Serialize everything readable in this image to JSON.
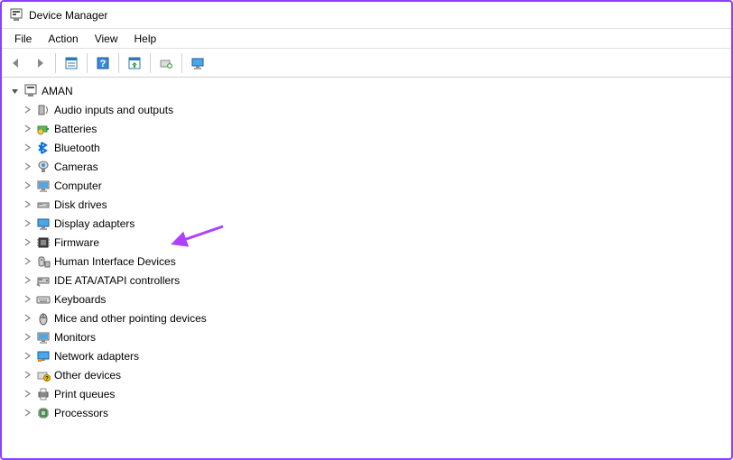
{
  "window": {
    "title": "Device Manager"
  },
  "menubar": {
    "items": [
      {
        "label": "File"
      },
      {
        "label": "Action"
      },
      {
        "label": "View"
      },
      {
        "label": "Help"
      }
    ]
  },
  "toolbar": {
    "buttons": [
      "back",
      "forward",
      "sep",
      "show-hidden",
      "help",
      "sep",
      "scan-hardware",
      "add-legacy",
      "sep",
      "remote"
    ]
  },
  "tree": {
    "root": {
      "label": "AMAN",
      "expanded": true
    },
    "categories": [
      {
        "icon": "audio",
        "label": "Audio inputs and outputs"
      },
      {
        "icon": "battery",
        "label": "Batteries"
      },
      {
        "icon": "bluetooth",
        "label": "Bluetooth"
      },
      {
        "icon": "camera",
        "label": "Cameras"
      },
      {
        "icon": "computer",
        "label": "Computer"
      },
      {
        "icon": "disk",
        "label": "Disk drives"
      },
      {
        "icon": "display",
        "label": "Display adapters"
      },
      {
        "icon": "firmware",
        "label": "Firmware"
      },
      {
        "icon": "hid",
        "label": "Human Interface Devices"
      },
      {
        "icon": "ide",
        "label": "IDE ATA/ATAPI controllers"
      },
      {
        "icon": "keyboard",
        "label": "Keyboards"
      },
      {
        "icon": "mouse",
        "label": "Mice and other pointing devices"
      },
      {
        "icon": "monitor",
        "label": "Monitors"
      },
      {
        "icon": "network",
        "label": "Network adapters"
      },
      {
        "icon": "other",
        "label": "Other devices"
      },
      {
        "icon": "print",
        "label": "Print queues"
      },
      {
        "icon": "processor",
        "label": "Processors"
      }
    ]
  },
  "annotation": {
    "target": "Display adapters",
    "color": "#b040ff"
  }
}
